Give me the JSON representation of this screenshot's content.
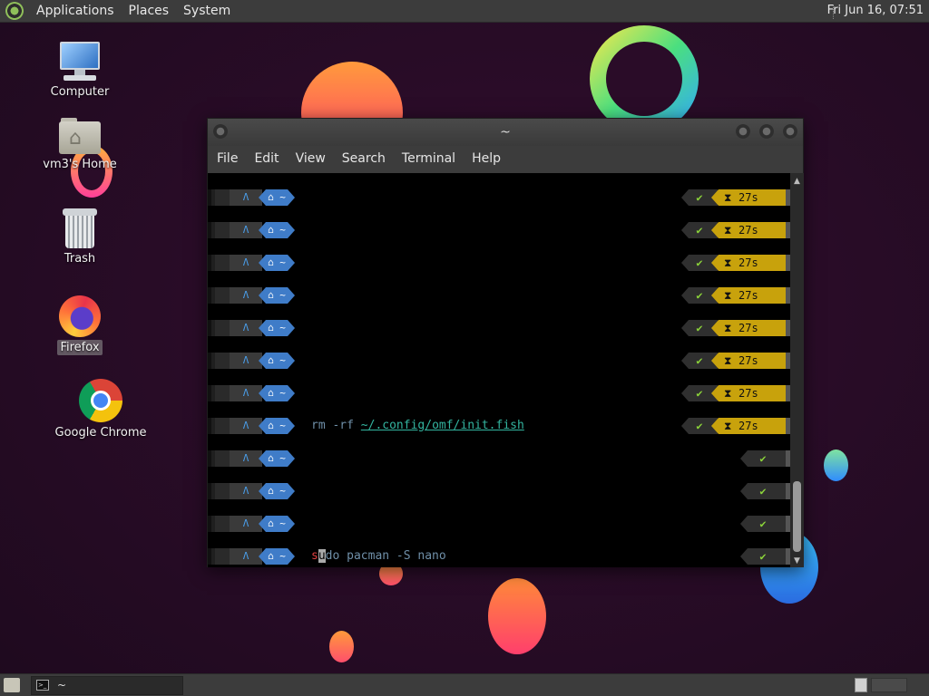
{
  "top_panel": {
    "menus": [
      "Applications",
      "Places",
      "System"
    ],
    "clock": "Fri Jun 16, 07:51"
  },
  "desktop_icons": {
    "computer": "Computer",
    "home": "vm3's Home",
    "trash": "Trash",
    "firefox": "Firefox",
    "chrome": "Google Chrome"
  },
  "terminal": {
    "title": "~",
    "menu": [
      "File",
      "Edit",
      "View",
      "Search",
      "Terminal",
      "Help"
    ],
    "prompt": {
      "arch_glyph": "Λ",
      "home_glyph": "⌂ ~",
      "check": "✔",
      "hourglass": "⧗",
      "duration": "27s"
    },
    "lines": [
      {
        "cmd": "",
        "status": "timed"
      },
      {
        "cmd": "",
        "status": "timed"
      },
      {
        "cmd": "",
        "status": "timed"
      },
      {
        "cmd": "",
        "status": "timed"
      },
      {
        "cmd": "",
        "status": "timed"
      },
      {
        "cmd": "",
        "status": "timed"
      },
      {
        "cmd": "",
        "status": "timed"
      },
      {
        "cmd": "rm -rf ~/.config/omf/init.fish",
        "status": "timed"
      },
      {
        "cmd": "",
        "status": "ok"
      },
      {
        "cmd": "",
        "status": "ok"
      },
      {
        "cmd": "",
        "status": "ok"
      },
      {
        "cmd": "sudo pacman -S nano",
        "status": "ok"
      }
    ],
    "cmd_rm": {
      "a": "rm -rf ",
      "path": "~/.config/omf/init.fish"
    },
    "cmd_sudo": {
      "s": "s",
      "cursor": "u",
      "rest": "do pacman -S nano"
    }
  },
  "taskbar": {
    "task_label": "~"
  }
}
